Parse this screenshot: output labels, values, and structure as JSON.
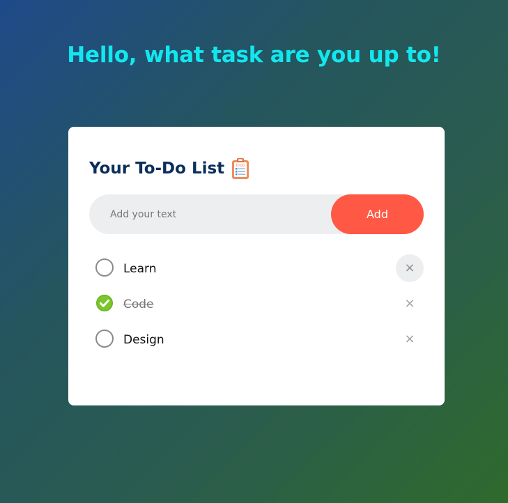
{
  "header": {
    "title": "Hello, what task are you up to!"
  },
  "card": {
    "title": "Your To-Do List",
    "title_icon": "clipboard-todo-icon"
  },
  "input": {
    "placeholder": "Add your text",
    "value": "",
    "add_label": "Add"
  },
  "tasks": [
    {
      "label": "Learn",
      "checked": false,
      "remove_label": "×"
    },
    {
      "label": "Code",
      "checked": true,
      "remove_label": "×"
    },
    {
      "label": "Design",
      "checked": false,
      "remove_label": "×"
    }
  ],
  "colors": {
    "headline": "#12e7ee",
    "title": "#0b2e5c",
    "accent": "#ff5845",
    "check_done": "#6ab320"
  }
}
